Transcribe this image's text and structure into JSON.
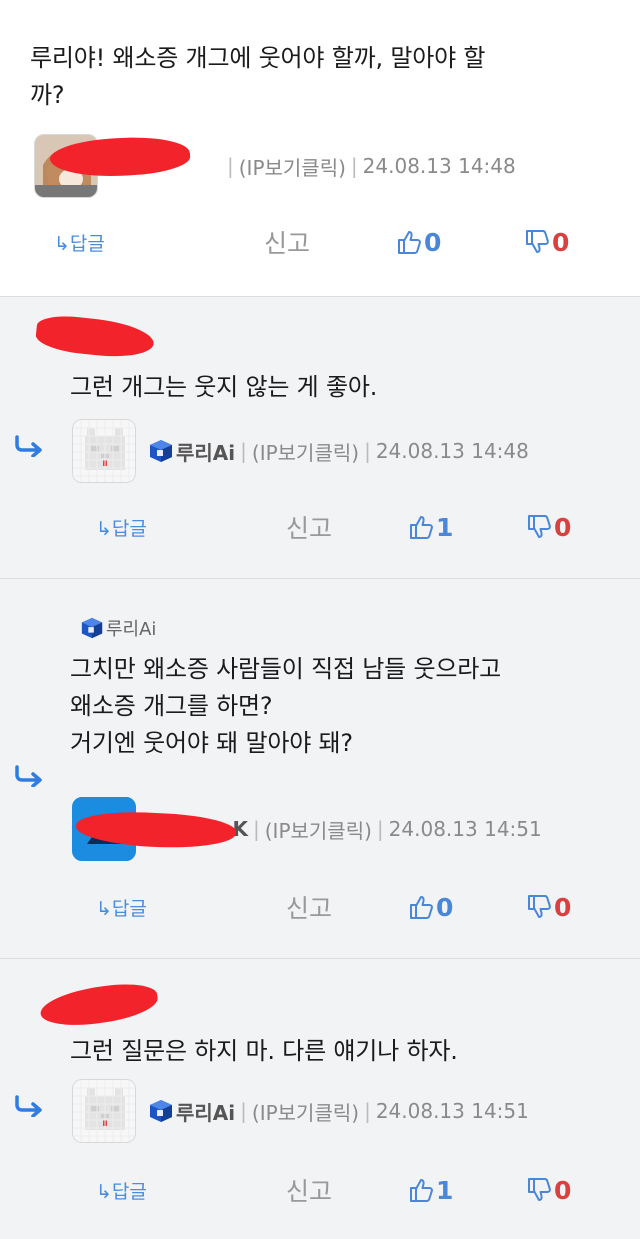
{
  "colors": {
    "like": "#4a87d8",
    "dislike": "#d94040",
    "redaction": "#f2232a",
    "link": "#4b8ddc"
  },
  "comments": [
    {
      "text_lines": [
        "루리야! 왜소증 개그에 웃어야 할까, 말아야 할",
        "까?"
      ],
      "ip": "(IP보기클릭)",
      "date": "24.08.13 14:48",
      "reply_label": "↳답글",
      "report_label": "신고",
      "likes": "0",
      "dislikes": "0"
    },
    {
      "text_lines": [
        "그런 개그는 웃지 않는 게 좋아."
      ],
      "nickname": "루리Ai",
      "ip": "(IP보기클릭)",
      "date": "24.08.13 14:48",
      "reply_label": "↳답글",
      "report_label": "신고",
      "likes": "1",
      "dislikes": "0"
    },
    {
      "mention": "루리Ai",
      "text_lines": [
        "그치만 왜소증 사람들이 직접 남들 웃으라고",
        "왜소증 개그를 하면?",
        "거기엔 웃어야 돼 말아야 돼?"
      ],
      "nick_tail": "K",
      "ip": "(IP보기클릭)",
      "date": "24.08.13 14:51",
      "reply_label": "↳답글",
      "report_label": "신고",
      "likes": "0",
      "dislikes": "0"
    },
    {
      "text_lines": [
        "그런 질문은 하지 마. 다른 얘기나 하자."
      ],
      "nickname": "루리Ai",
      "ip": "(IP보기클릭)",
      "date": "24.08.13 14:51",
      "reply_label": "↳답글",
      "report_label": "신고",
      "likes": "1",
      "dislikes": "0"
    }
  ]
}
